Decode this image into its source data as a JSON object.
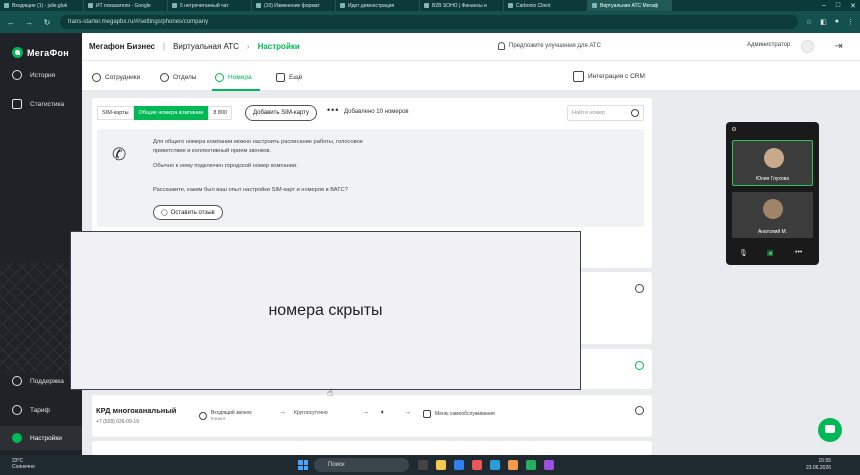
{
  "browser": {
    "tabs": [
      {
        "label": "Входящие (1) - julie.gluk",
        "active": false
      },
      {
        "label": "ИТ показатели - Google",
        "active": false
      },
      {
        "label": "5 нетрочитанный чат",
        "active": false
      },
      {
        "label": "(10) Изменение формат",
        "active": false
      },
      {
        "label": "Идет демонстрация",
        "active": false
      },
      {
        "label": "B2B SOHO | Финансы и",
        "active": false
      },
      {
        "label": "Carbonio Client",
        "active": false
      },
      {
        "label": "Виртуальная АТС Мегаф",
        "active": true
      }
    ],
    "url": "trans-starter.megapbx.ru/#/settings/phones/company"
  },
  "sidebar": {
    "logo": "МегаФон",
    "items": [
      {
        "label": "История",
        "icon": "history-icon"
      },
      {
        "label": "Статистика",
        "icon": "statistics-icon"
      },
      {
        "label": "Поддержка",
        "icon": "support-icon"
      },
      {
        "label": "Тариф",
        "icon": "tariff-icon"
      },
      {
        "label": "Настройки",
        "icon": "settings-icon",
        "active": true
      }
    ]
  },
  "header": {
    "crumb1": "Мегафон Бизнес",
    "crumb2": "Виртуальная АТС",
    "crumb3": "Настройки",
    "suggest": "Предложите улучшения для АТС",
    "user": "Администратор"
  },
  "subtabs": {
    "items": [
      "Сотрудники",
      "Отделы",
      "Номера",
      "Ещё"
    ],
    "active": "Номера",
    "crm": "Интеграция с CRM"
  },
  "toolbar": {
    "filters": [
      "SIM-карты",
      "Общие номера компании",
      "8 800"
    ],
    "active_filter": "Общие номера компании",
    "add_sim": "Добавить SIM-карту",
    "added": "Добавлено 10 номеров",
    "search_placeholder": "Найти номер"
  },
  "info": {
    "line1": "Для общего номера компании можно настроить расписание работы, голосовое",
    "line2": "приветствие и коллективный прием звонков.",
    "line3": "Обычно к нему подключен городской номер компании.",
    "line4": "Расскажите, каким был ваш опыт настройки SIM-карт и номеров в ВАТС?",
    "feedback": "Оставить отзыв"
  },
  "row": {
    "name": "КРД многоканальный",
    "number": "+7 (928) 036-09-19",
    "step1": "Входящий звонок",
    "step1_sub": "Клиент",
    "step2": "Круглосуточно",
    "step4": "Меню самообслуживания"
  },
  "overlay": {
    "text": "номера скрыты"
  },
  "video": {
    "participants": [
      "Юлия Глухова",
      "Анатолий М."
    ]
  },
  "taskbar": {
    "temp": "23°C",
    "weather": "Солнечно",
    "search": "Поиск",
    "time": "15:55",
    "date": "23.06.2026"
  }
}
